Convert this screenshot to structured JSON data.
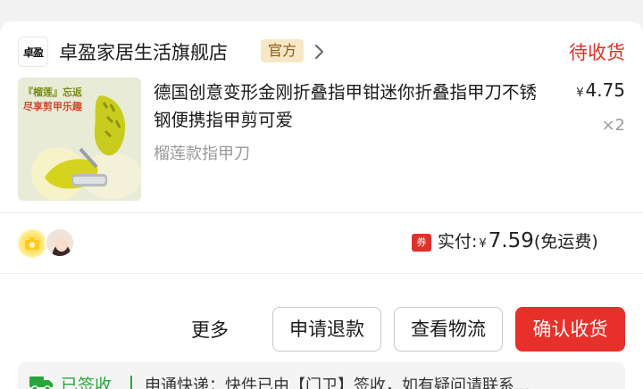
{
  "store": {
    "logo_text": "卓盈",
    "name": "卓盈家居生活旗舰店",
    "badge": "官方",
    "order_status": "待收货"
  },
  "product": {
    "thumb_text_1": "『榴莲』忘返",
    "thumb_text_2": "尽享剪甲乐趣",
    "title": "德国创意变形金刚折叠指甲钳迷你折叠指甲刀不锈钢便携指甲剪可爱",
    "spec": "榴莲款指甲刀",
    "price_currency": "¥",
    "price": "4.75",
    "quantity": "×2"
  },
  "total": {
    "coupon": "券",
    "label": "实付:",
    "currency": "¥",
    "amount": "7.59",
    "shipping_note": "(免运费)"
  },
  "actions": {
    "more": "更多",
    "refund": "申请退款",
    "logistics": "查看物流",
    "confirm": "确认收货"
  },
  "logistics": {
    "status": "已签收",
    "message": "申通快递：快件已由【门卫】签收，如有疑问请联系..."
  },
  "colors": {
    "accent_red": "#e8302a",
    "status_green": "#2aa53d",
    "badge_bg": "#f7e7c6"
  },
  "icons": {
    "store_chevron": "chevron-right-icon",
    "truck": "truck-icon",
    "camera": "camera-icon"
  }
}
